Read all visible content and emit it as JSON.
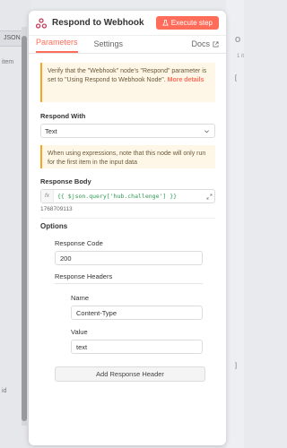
{
  "left": {
    "tab": "JSON",
    "item_text": "item",
    "id_text": "id"
  },
  "right": {
    "header": "O",
    "sub": "1 it",
    "bracket_open": "[",
    "bracket_close": "]"
  },
  "header": {
    "title": "Respond to Webhook",
    "execute_label": "Execute step"
  },
  "tabs": [
    {
      "label": "Parameters"
    },
    {
      "label": "Settings"
    }
  ],
  "docs_label": "Docs",
  "notice": {
    "text": "Verify that the \"Webhook\" node's \"Respond\" parameter is set to \"Using Respond to Webhook Node\". ",
    "link": "More details"
  },
  "respond_with": {
    "label": "Respond With",
    "value": "Text"
  },
  "expr_notice": "When using expressions, note that this node will only run for the first item in the input data",
  "response_body": {
    "label": "Response Body",
    "fx": "fx",
    "expression": "{{ $json.query['hub.challenge'] }}",
    "resolved": "1768709113"
  },
  "options": {
    "label": "Options",
    "response_code": {
      "label": "Response Code",
      "value": "200"
    },
    "headers": {
      "label": "Response Headers",
      "name_label": "Name",
      "name_value": "Content-Type",
      "value_label": "Value",
      "value_value": "text"
    },
    "add_header_label": "Add Response Header"
  },
  "colors": {
    "accent": "#ff6d5a",
    "notice_bg": "#fef6e6",
    "notice_border": "#f5a623",
    "expr_green": "#2c9b51"
  }
}
